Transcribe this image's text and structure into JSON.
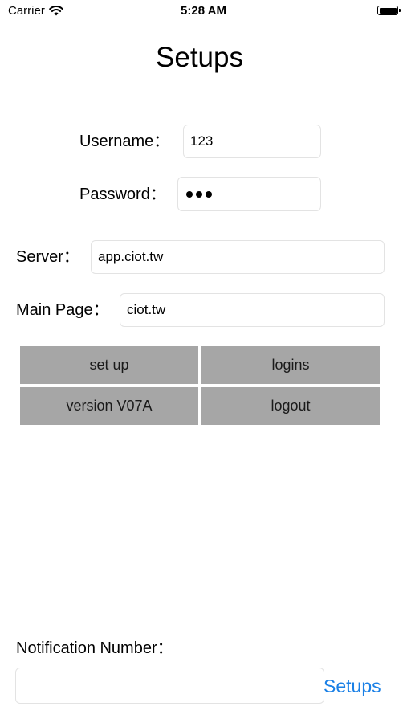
{
  "status_bar": {
    "carrier": "Carrier",
    "time": "5:28 AM"
  },
  "title": "Setups",
  "form": {
    "username_label": "Username：",
    "username_value": "123",
    "password_label": "Password：",
    "password_masked": "•••",
    "server_label": "Server：",
    "server_value": "app.ciot.tw",
    "main_page_label": "Main Page：",
    "main_page_value": "ciot.tw"
  },
  "buttons": {
    "set_up": "set up",
    "logins": "logins",
    "version": "version V07A",
    "logout": "logout"
  },
  "notification": {
    "label": "Notification Number：",
    "value": "",
    "setups_button": "Setups"
  },
  "colors": {
    "button_gray": "#a6a6a6",
    "link_blue": "#1a80e6",
    "field_border": "#e3e3e3"
  }
}
